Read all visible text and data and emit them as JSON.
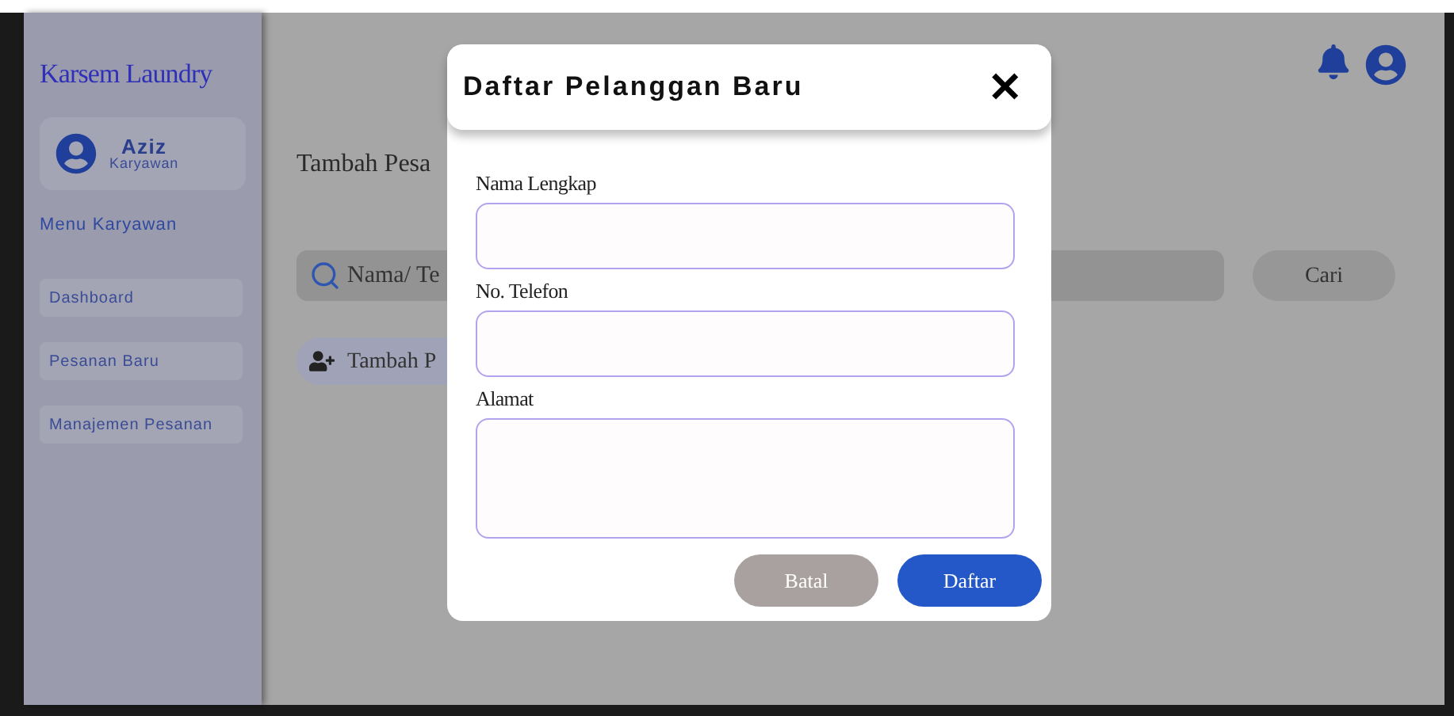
{
  "sidebar": {
    "brand": "Karsem Laundry",
    "user": {
      "name": "Aziz",
      "role": "Karyawan"
    },
    "menu_title": "Menu Karyawan",
    "items": [
      {
        "label": "Dashboard"
      },
      {
        "label": "Pesanan Baru"
      },
      {
        "label": "Manajemen Pesanan"
      }
    ]
  },
  "main": {
    "heading": "Tambah Pesa",
    "search": {
      "placeholder": "Nama/ Te"
    },
    "search_button": "Cari",
    "add_button": "Tambah P"
  },
  "dialog": {
    "title": "Daftar Pelanggan Baru",
    "close": "✕",
    "fields": [
      {
        "label": "Nama Lengkap",
        "kind": "input"
      },
      {
        "label": "No. Telefon",
        "kind": "input"
      },
      {
        "label": "Alamat",
        "kind": "textarea"
      }
    ],
    "buttons": [
      {
        "label": "Batal",
        "kind": "secondary"
      },
      {
        "label": "Daftar",
        "kind": "primary"
      }
    ]
  }
}
